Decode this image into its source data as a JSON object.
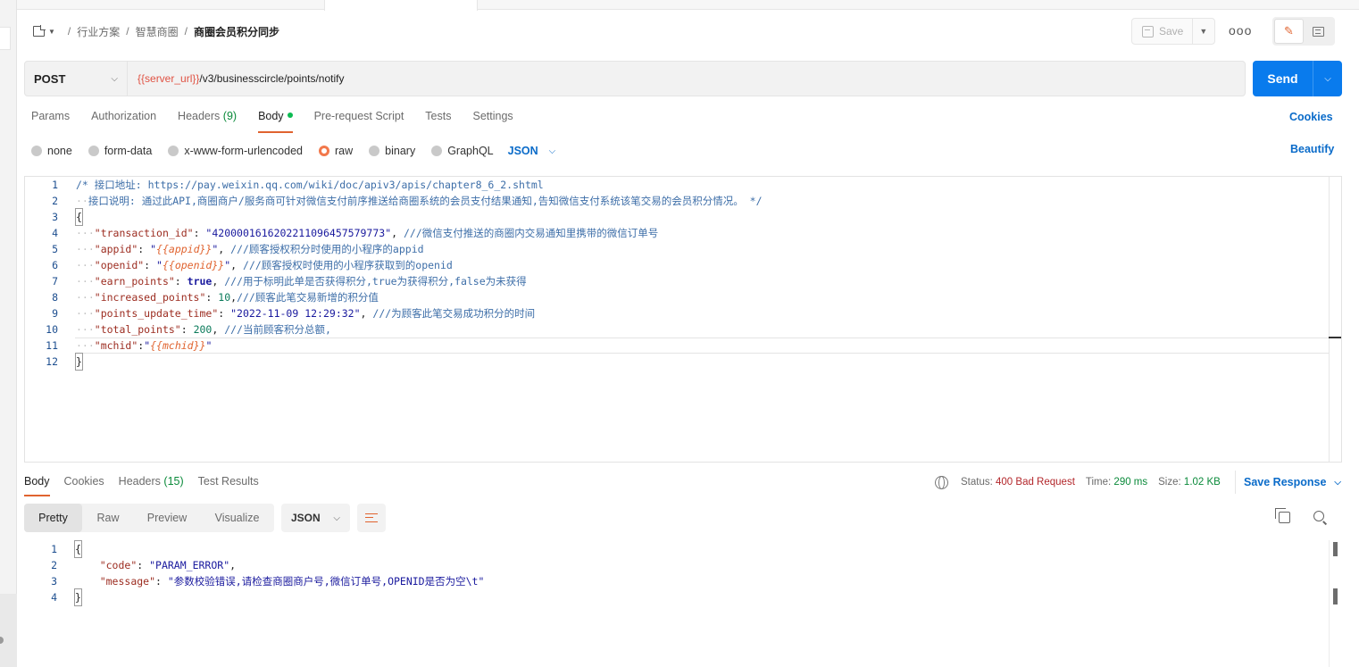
{
  "breadcrumb": {
    "items": [
      "行业方案",
      "智慧商圈"
    ],
    "current": "商圈会员积分同步"
  },
  "toolbar": {
    "save_label": "Save",
    "more_label": "ooo"
  },
  "request": {
    "method": "POST",
    "url_var": "{{server_url}}",
    "url_path": "/v3/businesscircle/points/notify",
    "send_label": "Send"
  },
  "request_tabs": {
    "params": "Params",
    "authorization": "Authorization",
    "headers": "Headers",
    "headers_count": "(9)",
    "body": "Body",
    "prerequest": "Pre-request Script",
    "tests": "Tests",
    "settings": "Settings",
    "cookies": "Cookies"
  },
  "body_types": {
    "none": "none",
    "form_data": "form-data",
    "urlencoded": "x-www-form-urlencoded",
    "raw": "raw",
    "binary": "binary",
    "graphql": "GraphQL",
    "format": "JSON",
    "beautify": "Beautify"
  },
  "editor": {
    "lines": [
      {
        "n": "1",
        "segs": [
          [
            "c-com",
            "/* 接口地址: https://pay.weixin.qq.com/wiki/doc/apiv3/apis/chapter8_6_2.shtml"
          ]
        ]
      },
      {
        "n": "2",
        "segs": [
          [
            "c-ws",
            "··"
          ],
          [
            "c-com",
            "接口说明: 通过此API,商圈商户/服务商可针对微信支付前序推送给商圈系统的会员支付结果通知,告知微信支付系统该笔交易的会员积分情况。 */"
          ]
        ]
      },
      {
        "n": "3",
        "segs": [
          [
            "c-pun",
            "{"
          ]
        ]
      },
      {
        "n": "4",
        "segs": [
          [
            "c-ws",
            "···"
          ],
          [
            "c-key",
            "\"transaction_id\""
          ],
          [
            "c-pun",
            ": "
          ],
          [
            "c-str",
            "\"4200001616202211096457579773\""
          ],
          [
            "c-pun",
            ", "
          ],
          [
            "c-com",
            "///微信支付推送的商圈内交易通知里携带的微信订单号"
          ]
        ]
      },
      {
        "n": "5",
        "segs": [
          [
            "c-ws",
            "···"
          ],
          [
            "c-key",
            "\"appid\""
          ],
          [
            "c-pun",
            ": "
          ],
          [
            "c-str",
            "\""
          ],
          [
            "c-var",
            "{{appid}}"
          ],
          [
            "c-str",
            "\""
          ],
          [
            "c-pun",
            ", "
          ],
          [
            "c-com",
            "///顾客授权积分时使用的小程序的appid"
          ]
        ]
      },
      {
        "n": "6",
        "segs": [
          [
            "c-ws",
            "···"
          ],
          [
            "c-key",
            "\"openid\""
          ],
          [
            "c-pun",
            ": "
          ],
          [
            "c-str",
            "\""
          ],
          [
            "c-var",
            "{{openid}}"
          ],
          [
            "c-str",
            "\""
          ],
          [
            "c-pun",
            ", "
          ],
          [
            "c-com",
            "///顾客授权时使用的小程序获取到的openid"
          ]
        ]
      },
      {
        "n": "7",
        "segs": [
          [
            "c-ws",
            "···"
          ],
          [
            "c-key",
            "\"earn_points\""
          ],
          [
            "c-pun",
            ": "
          ],
          [
            "c-kw",
            "true"
          ],
          [
            "c-pun",
            ", "
          ],
          [
            "c-com",
            "///用于标明此单是否获得积分,true为获得积分,false为未获得"
          ]
        ]
      },
      {
        "n": "8",
        "segs": [
          [
            "c-ws",
            "···"
          ],
          [
            "c-key",
            "\"increased_points\""
          ],
          [
            "c-pun",
            ": "
          ],
          [
            "c-num",
            "10"
          ],
          [
            "c-pun",
            ","
          ],
          [
            "c-com",
            "///顾客此笔交易新增的积分值"
          ]
        ]
      },
      {
        "n": "9",
        "segs": [
          [
            "c-ws",
            "···"
          ],
          [
            "c-key",
            "\"points_update_time\""
          ],
          [
            "c-pun",
            ": "
          ],
          [
            "c-str",
            "\"2022-11-09 12:29:32\""
          ],
          [
            "c-pun",
            ", "
          ],
          [
            "c-com",
            "///为顾客此笔交易成功积分的时间"
          ]
        ]
      },
      {
        "n": "10",
        "segs": [
          [
            "c-ws",
            "···"
          ],
          [
            "c-key",
            "\"total_points\""
          ],
          [
            "c-pun",
            ": "
          ],
          [
            "c-num",
            "200"
          ],
          [
            "c-pun",
            ", "
          ],
          [
            "c-com",
            "///当前顾客积分总额,"
          ]
        ]
      },
      {
        "n": "11",
        "segs": [
          [
            "c-ws",
            "···"
          ],
          [
            "c-key",
            "\"mchid\""
          ],
          [
            "c-pun",
            ":"
          ],
          [
            "c-str",
            "\""
          ],
          [
            "c-var",
            "{{mchid}}"
          ],
          [
            "c-str",
            "\""
          ]
        ]
      },
      {
        "n": "12",
        "segs": [
          [
            "c-pun",
            "}"
          ]
        ]
      }
    ]
  },
  "response_tabs": {
    "body": "Body",
    "cookies": "Cookies",
    "headers": "Headers",
    "headers_count": "(15)",
    "test_results": "Test Results"
  },
  "response_status": {
    "status_label": "Status:",
    "status_value": "400 Bad Request",
    "time_label": "Time:",
    "time_value": "290 ms",
    "size_label": "Size:",
    "size_value": "1.02 KB",
    "save_response": "Save Response"
  },
  "response_view": {
    "pretty": "Pretty",
    "raw": "Raw",
    "preview": "Preview",
    "visualize": "Visualize",
    "format": "JSON"
  },
  "response_body": {
    "lines": [
      {
        "n": "1",
        "segs": [
          [
            "c-pun",
            "{"
          ]
        ]
      },
      {
        "n": "2",
        "segs": [
          [
            "c-pun",
            "    "
          ],
          [
            "c-key",
            "\"code\""
          ],
          [
            "c-pun",
            ": "
          ],
          [
            "c-str",
            "\"PARAM_ERROR\""
          ],
          [
            "c-pun",
            ","
          ]
        ]
      },
      {
        "n": "3",
        "segs": [
          [
            "c-pun",
            "    "
          ],
          [
            "c-key",
            "\"message\""
          ],
          [
            "c-pun",
            ": "
          ],
          [
            "c-str",
            "\"参数校验错误,请检查商圈商户号,微信订单号,OPENID是否为空\\t\""
          ]
        ]
      },
      {
        "n": "4",
        "segs": [
          [
            "c-pun",
            "}"
          ]
        ]
      }
    ]
  },
  "colors": {
    "send": "#097bed",
    "accent": "#e0632f",
    "link": "#0a6bc9",
    "error_status": "#b3272b"
  }
}
